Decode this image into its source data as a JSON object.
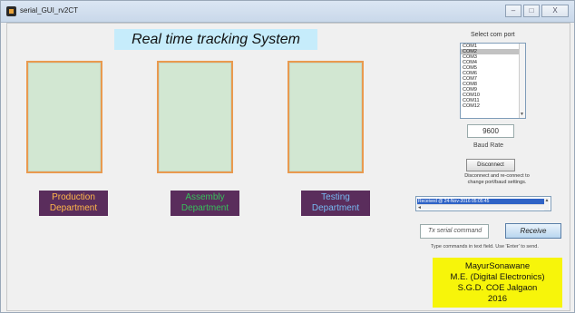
{
  "window": {
    "title": "serial_GUI_rv2CT",
    "minimize_glyph": "–",
    "maximize_glyph": "□",
    "close_glyph": "X"
  },
  "heading": "Real time tracking System",
  "departments": [
    {
      "label": "Production Department",
      "color": "#ffb64a"
    },
    {
      "label": "Assembly Department",
      "color": "#36c05a"
    },
    {
      "label": "Testing Department",
      "color": "#76b8f0"
    }
  ],
  "port": {
    "label": "Select com port",
    "options": [
      "COM1",
      "COM2",
      "COM3",
      "COM4",
      "COM5",
      "COM6",
      "COM7",
      "COM8",
      "COM9",
      "COM10",
      "COM11",
      "COM12"
    ],
    "selected": "COM2"
  },
  "baud": {
    "value": "9600",
    "label": "Baud Rate"
  },
  "connection": {
    "button_label": "Disconnect",
    "note": "Disconnect and re-connect to change port/baud settings."
  },
  "log": {
    "line": "Received @ 24-Nov-2016 05:05:45"
  },
  "tx": {
    "placeholder": "Tx serial command",
    "receive_label": "Receive",
    "note": "Type commands in text field. Use 'Enter' to send."
  },
  "credit": {
    "line1": "MayurSonawane",
    "line2": "M.E. (Digital Electronics)",
    "line3": "S.G.D. COE Jalgaon",
    "line4": "2016"
  },
  "colors": {
    "heading_bg": "#c6ecfb",
    "panel_bg": "#d2e7d2",
    "panel_border": "#e99a4f",
    "dept_bg": "#5a2d5c",
    "credit_bg": "#f7f50a"
  }
}
